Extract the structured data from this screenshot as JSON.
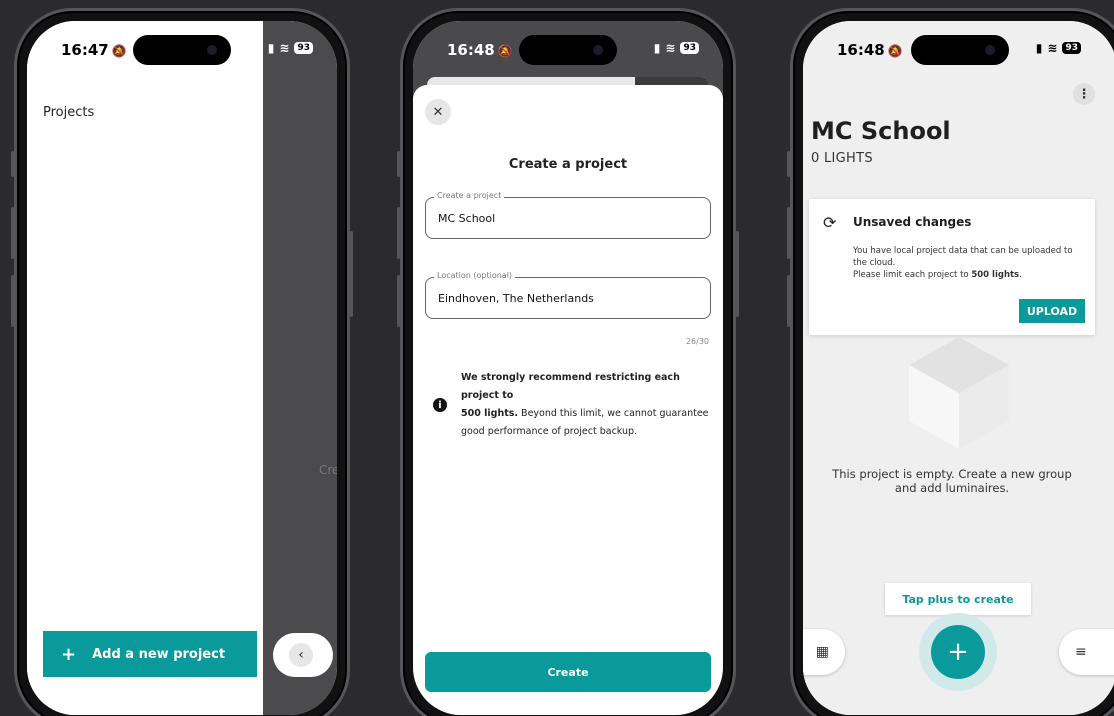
{
  "phone1": {
    "status": {
      "time": "16:47",
      "battery": "93"
    },
    "drawer_title": "Projects",
    "add_button": {
      "icon": "plus",
      "label": "Add a new project"
    },
    "back_icon": "chevron-left-icon",
    "partial_text": "Crea"
  },
  "phone2": {
    "status": {
      "time": "16:48",
      "battery": "93"
    },
    "heading": "Create a project",
    "project_field": {
      "label": "Create a project",
      "value": "MC School"
    },
    "location_field": {
      "label": "Location (optional)",
      "value": "Eindhoven, The Netherlands"
    },
    "counter": "26/30",
    "info": {
      "bold1": "We strongly recommend restricting each project to",
      "bold2": "500 lights.",
      "rest": " Beyond this limit, we cannot guarantee good performance of project backup."
    },
    "create_button": "Create"
  },
  "phone3": {
    "status": {
      "time": "16:48",
      "battery": "93"
    },
    "title": "MC School",
    "subtitle": "0 LIGHTS",
    "card": {
      "title": "Unsaved changes",
      "line1": "You have local project data that can be uploaded to the cloud.",
      "line2_prefix": "Please limit each project to ",
      "line2_bold": "500 lights",
      "line2_suffix": ".",
      "upload_button": "UPLOAD"
    },
    "empty_text": "This project is empty. Create a new group and add luminaires.",
    "tooltip": "Tap plus to create",
    "fab_label": "+"
  },
  "colors": {
    "accent": "#0a9a9b",
    "frame": "#55565a",
    "background": "#2b2b2d"
  }
}
